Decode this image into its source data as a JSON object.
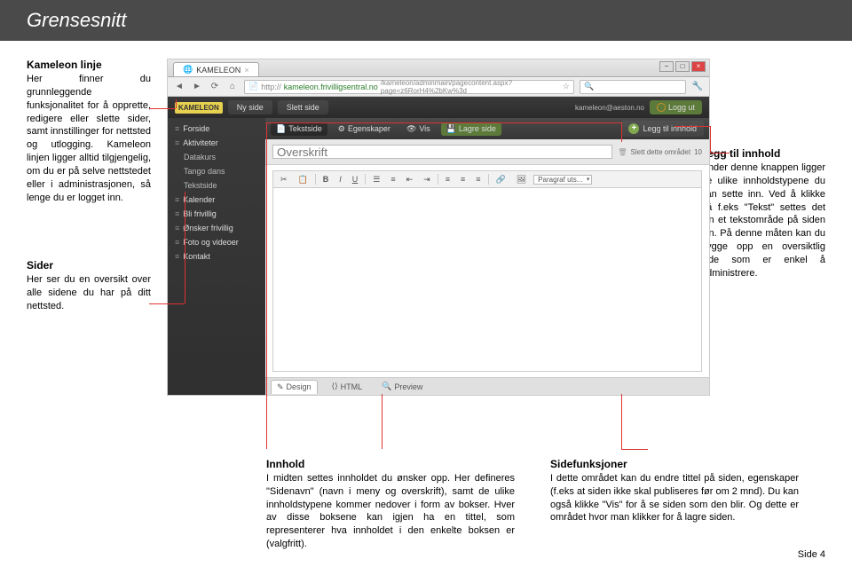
{
  "header": {
    "title": "Grensesnitt"
  },
  "left_blocks": [
    {
      "title": "Kameleon linje",
      "text": "Her finner du grunnleggende funksjonalitet for å opprette, redigere eller slette sider, samt innstillinger for nettsted og utlogging. Kameleon linjen ligger alltid tilgjengelig, om du er på selve nettstedet eller i administrasjonen, så lenge du er logget inn."
    },
    {
      "title": "Sider",
      "text": "Her ser du en oversikt over alle sidene du har på ditt nettsted."
    }
  ],
  "right_block": {
    "title": "Legg til innhold",
    "text": "Under denne knappen ligger de ulike innholdstypene du kan sette inn. Ved å klikke på f.eks \"Tekst\" settes det inn et tekstområde på siden din. På denne måten kan du bygge opp en oversiktlig side som er enkel å administrere."
  },
  "bottom_blocks": [
    {
      "title": "Innhold",
      "text": "I midten settes innholdet du ønsker opp. Her defineres \"Sidenavn\" (navn i meny og overskrift), samt de ulike innholdstypene kommer nedover i form av bokser. Hver av disse boksene kan igjen ha en tittel, som representerer hva innholdet i den enkelte boksen er (valgfritt)."
    },
    {
      "title": "Sidefunksjoner",
      "text": "I dette området kan du endre tittel på siden, egenskaper (f.eks  at siden ikke skal publiseres før om 2 mnd). Du kan også klikke \"Vis\" for å se siden som den blir. Og dette er området hvor man klikker for å lagre siden."
    }
  ],
  "page_number": "Side 4",
  "browser": {
    "tab_title": "KAMELEON",
    "url_prefix": "http://",
    "url_host": "kameleon.frivilligsentral.no",
    "url_path": "/kameleon/adminmain/pagecontent.aspx?page=z6RorH4%2bKw%3d",
    "window_min": "−",
    "window_max": "□",
    "window_close": "×"
  },
  "kameleon_bar": {
    "logo": "KAMELEON",
    "new_page": "Ny side",
    "delete_page": "Slett side",
    "user": "kameleon@aeston.no",
    "logout": "Logg ut"
  },
  "sidebar_items": [
    {
      "label": "Forside",
      "sub": false
    },
    {
      "label": "Aktiviteter",
      "sub": false
    },
    {
      "label": "Datakurs",
      "sub": true
    },
    {
      "label": "Tango dans",
      "sub": true
    },
    {
      "label": "Tekstside",
      "sub": true
    },
    {
      "label": "Kalender",
      "sub": false
    },
    {
      "label": "Bli frivillig",
      "sub": false
    },
    {
      "label": "Ønsker frivillig",
      "sub": false
    },
    {
      "label": "Foto og videoer",
      "sub": false
    },
    {
      "label": "Kontakt",
      "sub": false
    }
  ],
  "toolbar2": {
    "textpage": "Tekstside",
    "properties": "Egenskaper",
    "view": "Vis",
    "save": "Lagre side",
    "add_content": "Legg til innhold"
  },
  "field_row": {
    "placeholder": "Overskrift",
    "delete_area": "Slett dette området",
    "count": "10"
  },
  "editor_tools": {
    "bold": "B",
    "italic": "I",
    "underline": "U",
    "paragraph_sel": "Paragraf uts..."
  },
  "view_tabs": {
    "design": "Design",
    "html": "HTML",
    "preview": "Preview"
  }
}
